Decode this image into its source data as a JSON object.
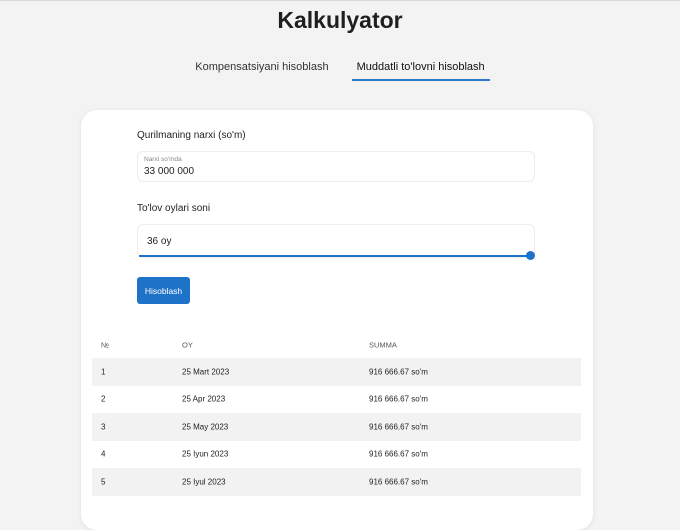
{
  "page": {
    "title": "Kalkulyator"
  },
  "tabs": [
    {
      "label": "Kompensatsiyani hisoblash",
      "active": false
    },
    {
      "label": "Muddatli to'lovni hisoblash",
      "active": true
    }
  ],
  "form": {
    "price_label": "Qurilmaning narxi (so'm)",
    "price_placeholder": "Narxi so'mda",
    "price_value": "33 000 000",
    "months_label": "To'lov oylari soni",
    "months_value": "36 oy",
    "slider_fraction": 1.0,
    "submit_label": "Hisoblash"
  },
  "table": {
    "headers": [
      "№",
      "OY",
      "SUMMA"
    ],
    "rows": [
      [
        "1",
        "25 Mart 2023",
        "916 666.67 so'm"
      ],
      [
        "2",
        "25 Apr 2023",
        "916 666.67 so'm"
      ],
      [
        "3",
        "25 May 2023",
        "916 666.67 so'm"
      ],
      [
        "4",
        "25 Iyun 2023",
        "916 666.67 so'm"
      ],
      [
        "5",
        "25 Iyul 2023",
        "916 666.67 so'm"
      ]
    ]
  },
  "colors": {
    "accent": "#1e73c8",
    "background": "#f3f3f3",
    "row_shade": "#f2f2f2"
  }
}
